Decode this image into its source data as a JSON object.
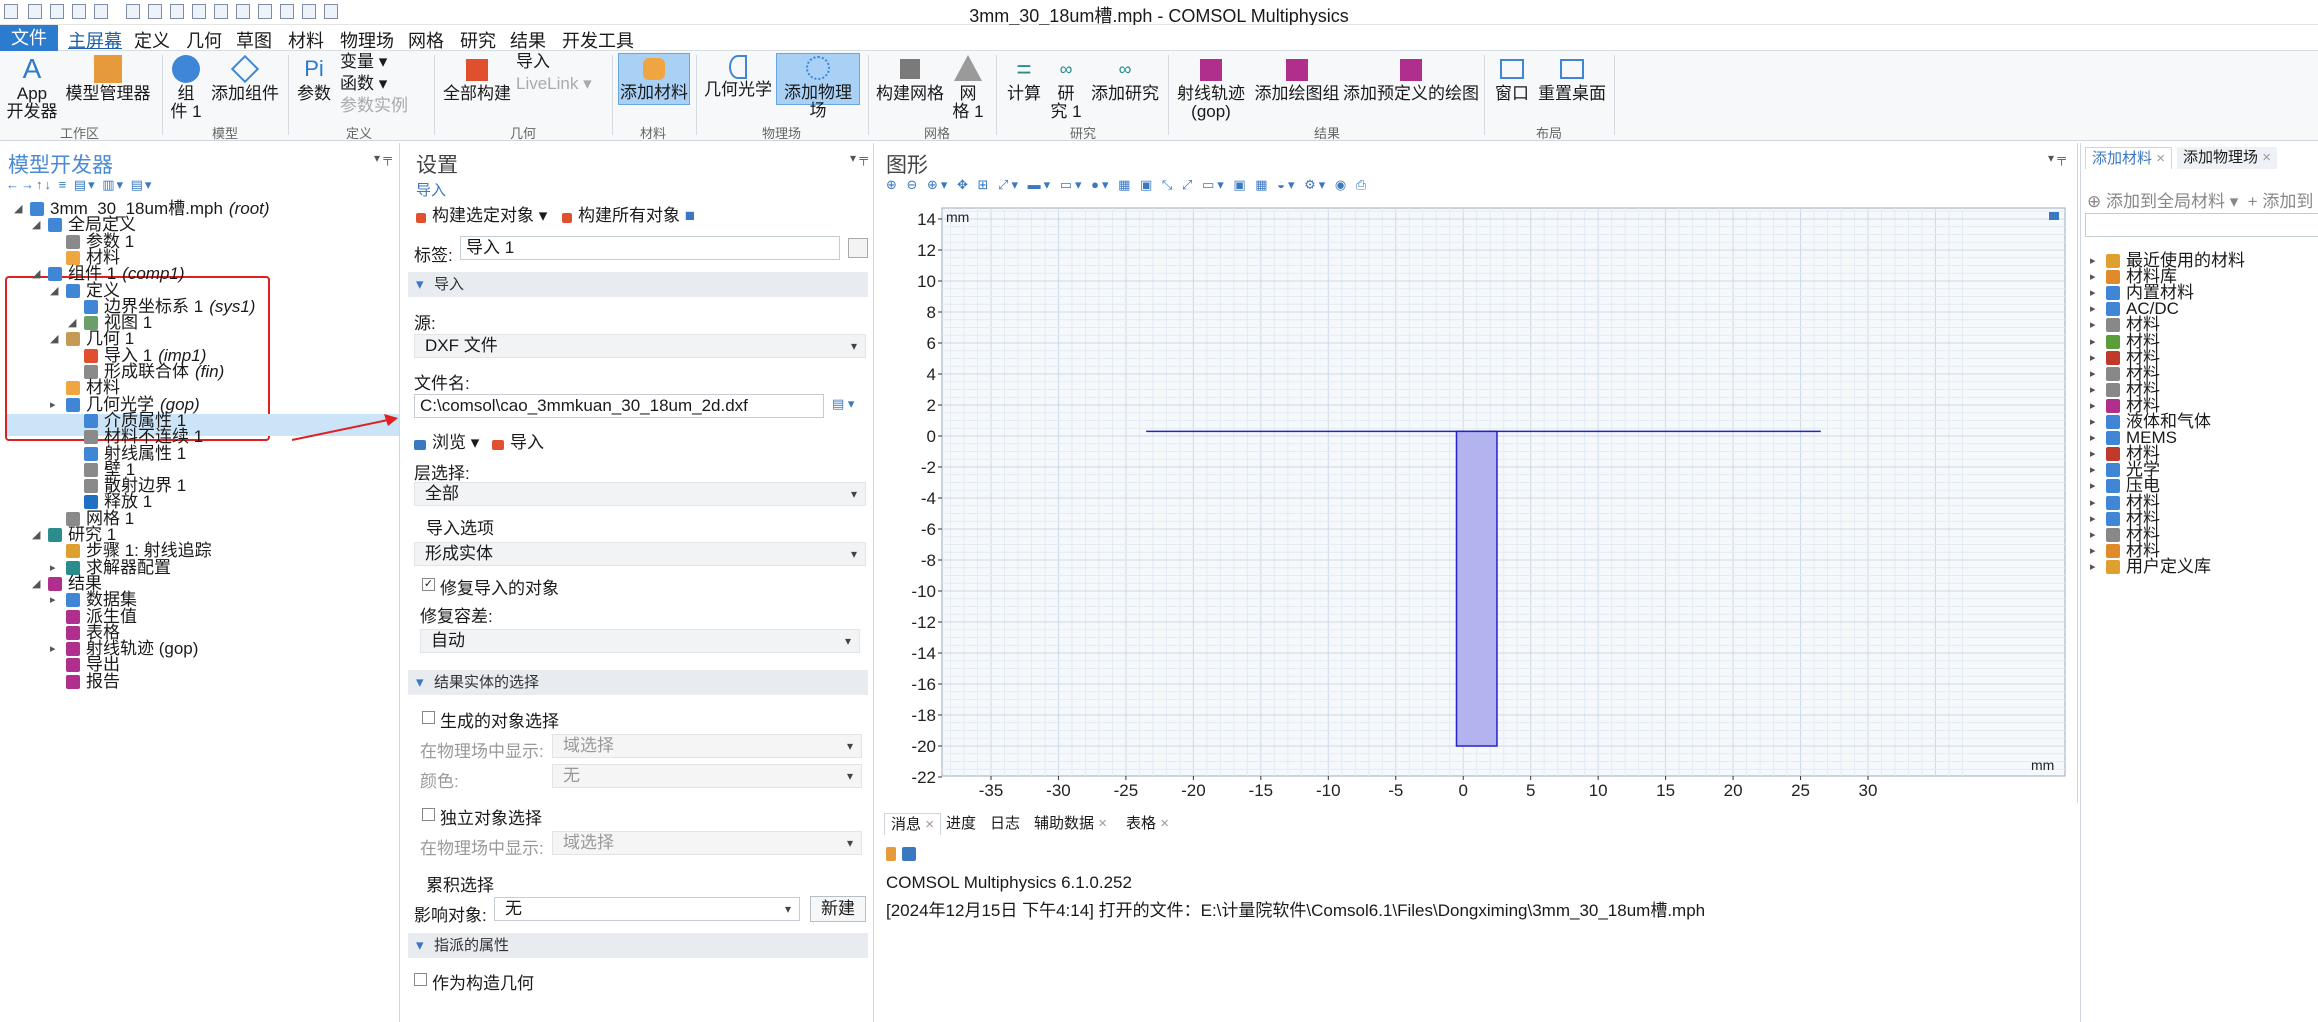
{
  "window": {
    "title": "3mm_30_18um槽.mph - COMSOL Multiphysics"
  },
  "menubar": {
    "file": "文件",
    "tabs": [
      "主屏幕",
      "定义",
      "几何",
      "草图",
      "材料",
      "物理场",
      "网格",
      "研究",
      "结果",
      "开发工具"
    ]
  },
  "ribbon": {
    "app_label1": "App",
    "app_label2": "开发器",
    "model_manager": "模型管理器",
    "workspace_group": "工作区",
    "component_label1": "组",
    "component_label2": "件 1",
    "add_component": "添加组件",
    "model_group": "模型",
    "parameters": "参数",
    "variables": "变量",
    "functions": "函数",
    "param_cases": "参数实例",
    "definitions_group": "定义",
    "build_all": "全部构建",
    "import": "导入",
    "livelink": "LiveLink",
    "geometry_group": "几何",
    "add_material": "添加材料",
    "materials_group": "材料",
    "geometric_optics": "几何光学",
    "add_physics": "添加物理场",
    "physics_group": "物理场",
    "build_mesh": "构建网格",
    "mesh_label1": "网",
    "mesh_label2": "格 1",
    "mesh_group": "网格",
    "compute": "计算",
    "study_label1": "研",
    "study_label2": "究 1",
    "add_study": "添加研究",
    "study_group": "研究",
    "ray_trajectories1": "射线轨迹",
    "ray_trajectories2": "(gop)",
    "add_plot_group": "添加绘图组",
    "add_predefined_plot": "添加预定义的绘图",
    "results_group": "结果",
    "windows": "窗口",
    "reset_desktop": "重置桌面",
    "layout_group": "布局"
  },
  "model_builder": {
    "title": "模型开发器",
    "tree": [
      {
        "label": "3mm_30_18um槽.mph",
        "tag": "(root)"
      },
      {
        "label": "全局定义",
        "tag": ""
      },
      {
        "label": "参数 1",
        "tag": ""
      },
      {
        "label": "材料",
        "tag": ""
      },
      {
        "label": "组件 1",
        "tag": "(comp1)"
      },
      {
        "label": "定义",
        "tag": ""
      },
      {
        "label": "边界坐标系 1",
        "tag": "(sys1)"
      },
      {
        "label": "视图 1",
        "tag": ""
      },
      {
        "label": "几何 1",
        "tag": ""
      },
      {
        "label": "导入 1",
        "tag": "(imp1)"
      },
      {
        "label": "形成联合体",
        "tag": "(fin)"
      },
      {
        "label": "材料",
        "tag": ""
      },
      {
        "label": "几何光学",
        "tag": "(gop)"
      },
      {
        "label": "介质属性 1",
        "tag": ""
      },
      {
        "label": "材料不连续 1",
        "tag": ""
      },
      {
        "label": "射线属性 1",
        "tag": ""
      },
      {
        "label": "壁 1",
        "tag": ""
      },
      {
        "label": "散射边界 1",
        "tag": ""
      },
      {
        "label": "释放 1",
        "tag": ""
      },
      {
        "label": "网格 1",
        "tag": ""
      },
      {
        "label": "研究 1",
        "tag": ""
      },
      {
        "label": "步骤 1: 射线追踪",
        "tag": ""
      },
      {
        "label": "求解器配置",
        "tag": ""
      },
      {
        "label": "结果",
        "tag": ""
      },
      {
        "label": "数据集",
        "tag": ""
      },
      {
        "label": "派生值",
        "tag": ""
      },
      {
        "label": "表格",
        "tag": ""
      },
      {
        "label": "射线轨迹 (gop)",
        "tag": ""
      },
      {
        "label": "导出",
        "tag": ""
      },
      {
        "label": "报告",
        "tag": ""
      }
    ]
  },
  "settings": {
    "title": "设置",
    "subtitle": "导入",
    "build_selected": "构建选定对象",
    "build_all": "构建所有对象",
    "label_caption": "标签:",
    "label_value": "导入 1",
    "section_import": "导入",
    "source_caption": "源:",
    "source_value": "DXF 文件",
    "filename_caption": "文件名:",
    "filename_value": "C:\\comsol\\cao_3mmkuan_30_18um_2d.dxf",
    "browse": "浏览",
    "import": "导入",
    "layer_caption": "层选择:",
    "layer_value": "全部",
    "import_options": "导入选项",
    "import_options_value": "形成实体",
    "repair_checkbox": "修复导入的对象",
    "repair_tol_caption": "修复容差:",
    "repair_tol_value": "自动",
    "section_selection": "结果实体的选择",
    "gen_selection": "生成的对象选择",
    "show_in_physics": "在物理场中显示:",
    "show_in_physics_value": "域选择",
    "color_caption": "颜色:",
    "color_value": "无",
    "separate_selection": "独立对象选择",
    "show_in_physics2": "在物理场中显示:",
    "show_in_physics2_value": "域选择",
    "cumulative": "累积选择",
    "affect_caption": "影响对象:",
    "affect_value": "无",
    "new_button": "新建",
    "section_assigned": "指派的属性",
    "construction_geometry": "作为构造几何"
  },
  "graphics": {
    "title": "图形",
    "unit_y": "mm",
    "unit_x": "mm",
    "y_ticks": [
      "14",
      "12",
      "10",
      "8",
      "6",
      "4",
      "2",
      "0",
      "-2",
      "-4",
      "-6",
      "-8",
      "-10",
      "-12",
      "-14",
      "-16",
      "-18",
      "-20",
      "-22"
    ],
    "x_ticks": [
      "-35",
      "-30",
      "-25",
      "-20",
      "-15",
      "-10",
      "-5",
      "0",
      "5",
      "10",
      "15",
      "20",
      "25",
      "30"
    ]
  },
  "messages": {
    "tabs": [
      "消息",
      "进度",
      "日志",
      "辅助数据",
      "表格"
    ],
    "lines": [
      "COMSOL Multiphysics 6.1.0.252",
      "[2024年12月15日 下午4:14] 打开的文件：E:\\计量院软件\\Comsol6.1\\Files\\Dongximing\\3mm_30_18um槽.mph"
    ]
  },
  "add_material": {
    "tabs": [
      "添加材料",
      "添加物理场"
    ],
    "add_to_global": "添加到全局材料",
    "add_to": "添加到",
    "items": [
      "最近使用的材料",
      "材料库",
      "内置材料",
      "AC/DC",
      "材料",
      "材料",
      "材料",
      "材料",
      "材料",
      "材料",
      "液体和气体",
      "MEMS",
      "材料",
      "光学",
      "压电",
      "材料",
      "材料",
      "材料",
      "材料",
      "用户定义库"
    ]
  },
  "colors": {
    "accent": "#2b7bce",
    "selection": "#cce4f7",
    "highlight_box": "#e02020",
    "domain_fill": "#b3b3f0",
    "domain_stroke": "#2323c8"
  }
}
